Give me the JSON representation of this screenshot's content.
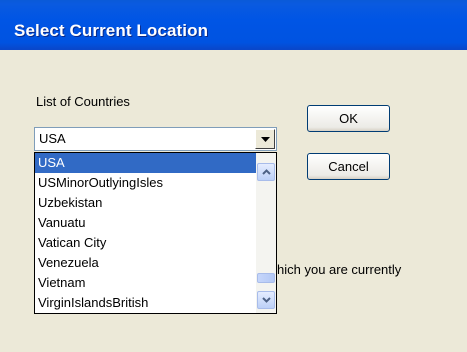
{
  "window": {
    "title": "Select Current Location"
  },
  "countries": {
    "label": "List of Countries",
    "selected": "USA",
    "items": [
      "USA",
      "USMinorOutlyingIsles",
      "Uzbekistan",
      "Vanuatu",
      "Vatican City",
      "Venezuela",
      "Vietnam",
      "VirginIslandsBritish"
    ]
  },
  "buttons": {
    "ok": "OK",
    "cancel": "Cancel"
  },
  "partial_text": "hich you are currently",
  "icons": {
    "combo_arrow": "chevron-down-icon",
    "scroll_up": "chevron-up-icon",
    "scroll_down": "chevron-down-icon"
  },
  "colors": {
    "titlebar": "#0055e5",
    "selection": "#316ac5",
    "dialog_bg": "#ece9d8"
  }
}
